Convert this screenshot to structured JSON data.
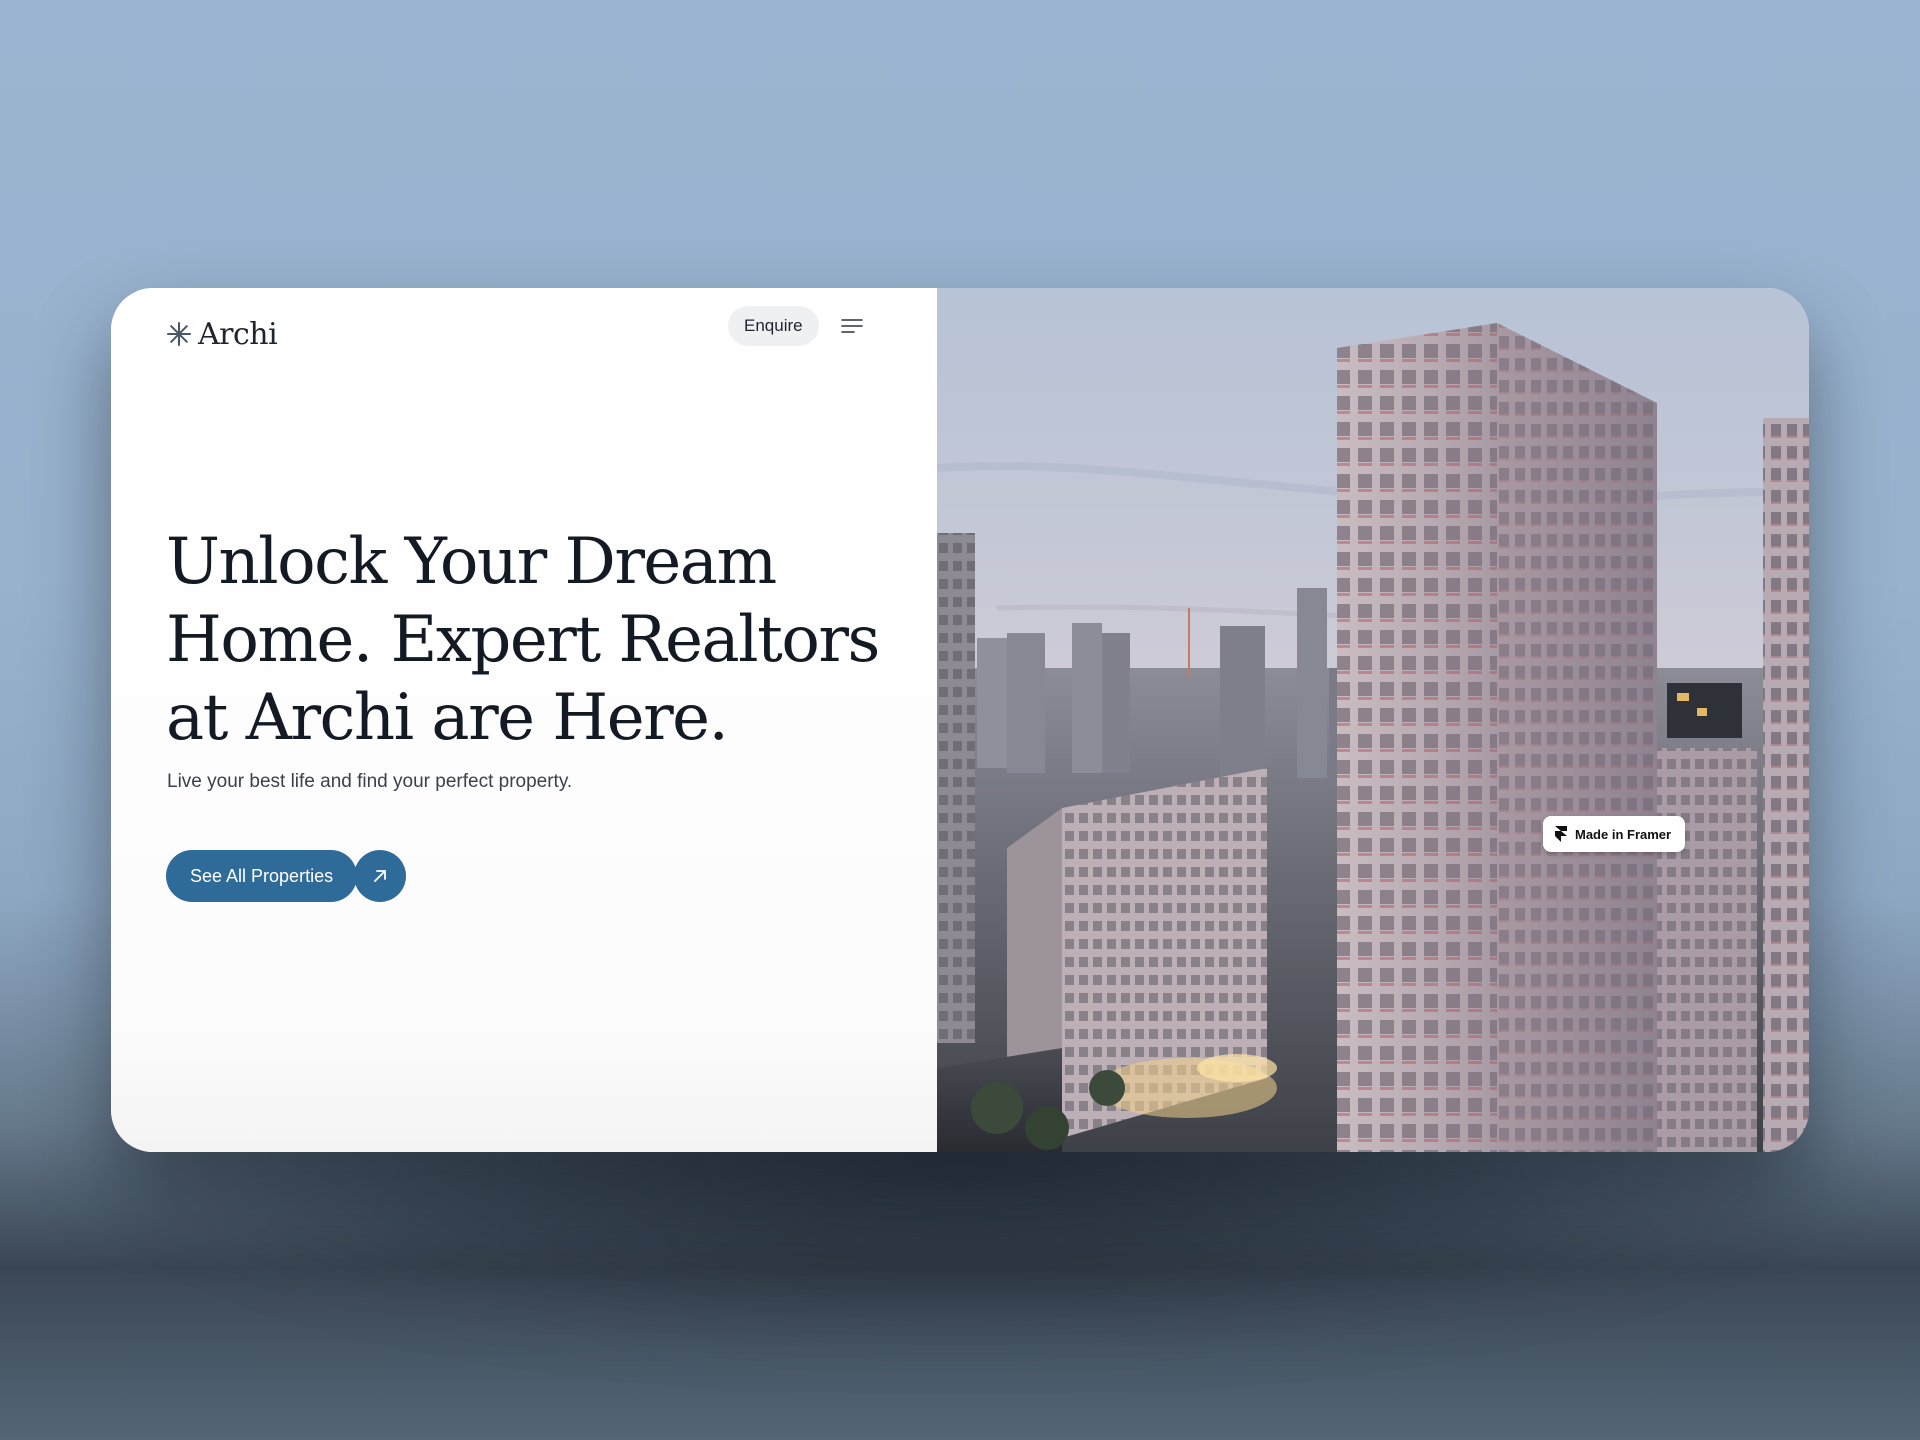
{
  "brand": {
    "name": "Archi",
    "logo_icon": "asterisk-icon"
  },
  "nav": {
    "enquire_label": "Enquire",
    "menu_icon": "menu-icon"
  },
  "hero": {
    "headline_line1": "Unlock Your Dream",
    "headline_line2": "Home. Expert Realtors",
    "headline_line3": "at Archi are Here.",
    "subtitle": "Live your best life and find your perfect property.",
    "cta_label": "See All Properties",
    "cta_icon": "arrow-up-right-icon"
  },
  "badge": {
    "label": "Made in Framer",
    "icon": "framer-icon"
  },
  "colors": {
    "accent": "#2f6b98",
    "text_dark": "#141a24",
    "background_top": "#9ab4d1",
    "enquire_bg": "#eef0f2"
  }
}
